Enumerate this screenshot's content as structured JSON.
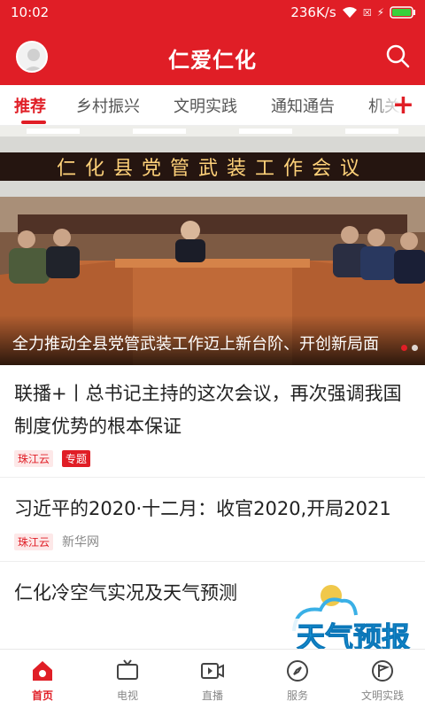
{
  "status_bar": {
    "time": "10:02",
    "net_speed": "236K/s"
  },
  "header": {
    "title": "仁爱仁化"
  },
  "tabs": [
    {
      "label": "推荐",
      "active": true
    },
    {
      "label": "乡村振兴"
    },
    {
      "label": "文明实践"
    },
    {
      "label": "通知通告"
    },
    {
      "label": "机关"
    }
  ],
  "banner": {
    "sign_text": "仁化县党管武装工作会议",
    "caption": "全力推动全县党管武装工作迈上新台阶、开创新局面"
  },
  "news": [
    {
      "title": "联播+丨总书记主持的这次会议，再次强调我国制度优势的根本保证",
      "tags": [
        "珠江云",
        "专题"
      ]
    },
    {
      "title": "习近平的2020·十二月：收官2020,开局2021",
      "tags": [
        "珠江云"
      ],
      "source": "新华网"
    },
    {
      "title": "仁化冷空气实况及天气预测"
    }
  ],
  "weather_logo": {
    "text": "天气预报"
  },
  "bottom_nav": [
    {
      "label": "首页",
      "icon": "home-icon",
      "active": true
    },
    {
      "label": "电视",
      "icon": "tv-icon"
    },
    {
      "label": "直播",
      "icon": "live-icon"
    },
    {
      "label": "服务",
      "icon": "compass-icon"
    },
    {
      "label": "文明实践",
      "icon": "flag-icon"
    }
  ],
  "colors": {
    "brand": "#e01e26"
  }
}
